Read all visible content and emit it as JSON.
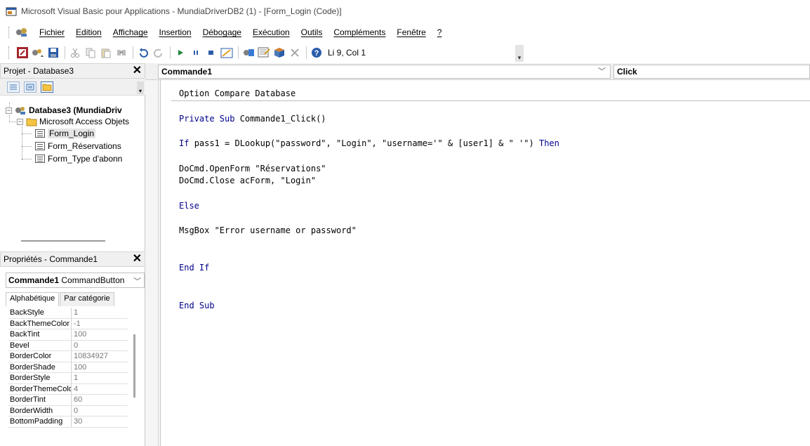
{
  "window": {
    "title": "Microsoft Visual Basic pour Applications - MundiaDriverDB2 (1) - [Form_Login (Code)]"
  },
  "menu": {
    "items": [
      "Fichier",
      "Edition",
      "Affichage",
      "Insertion",
      "Débogage",
      "Exécution",
      "Outils",
      "Compléments",
      "Fenêtre",
      "?"
    ]
  },
  "toolbar": {
    "cursor_position": "Li 9, Col 1"
  },
  "project": {
    "title": "Projet - Database3",
    "tree": {
      "root": "Database3 (MundiaDriv",
      "folder": "Microsoft Access Objets",
      "items": [
        "Form_Login",
        "Form_Réservations",
        "Form_Type d'abonn"
      ]
    }
  },
  "properties": {
    "title": "Propriétés - Commande1",
    "object_name": "Commande1",
    "object_type": "CommandButton",
    "tabs": [
      "Alphabétique",
      "Par catégorie"
    ],
    "rows": [
      {
        "name": "BackStyle",
        "value": "1"
      },
      {
        "name": "BackThemeColor",
        "value": "-1"
      },
      {
        "name": "BackTint",
        "value": "100"
      },
      {
        "name": "Bevel",
        "value": "0"
      },
      {
        "name": "BorderColor",
        "value": "10834927"
      },
      {
        "name": "BorderShade",
        "value": "100"
      },
      {
        "name": "BorderStyle",
        "value": "1"
      },
      {
        "name": "BorderThemeColor",
        "value": "4"
      },
      {
        "name": "BorderTint",
        "value": "60"
      },
      {
        "name": "BorderWidth",
        "value": "0"
      },
      {
        "name": "BottomPadding",
        "value": "30"
      }
    ]
  },
  "code": {
    "object_combo": "Commande1",
    "procedure_combo": "Click",
    "lines": [
      {
        "text": "Option Compare Database"
      },
      {
        "kw": "Private Sub ",
        "text": "Commande1_Click()"
      },
      {
        "kw": "If ",
        "text": "pass1 = DLookup(\"password\", \"Login\", \"username='\" & [user1] & \" '\") ",
        "kw2": "Then"
      },
      {
        "text": "DoCmd.OpenForm \"Réservations\""
      },
      {
        "text": "DoCmd.Close acForm, \"Login\""
      },
      {
        "kw": "Else"
      },
      {
        "text": "MsgBox \"Error username or password\""
      },
      {
        "kw": "End If"
      },
      {
        "kw": "End Sub"
      }
    ]
  },
  "colors": {
    "keyword": "#00008b",
    "background": "#ffffff",
    "panel": "#f0f0f0"
  }
}
